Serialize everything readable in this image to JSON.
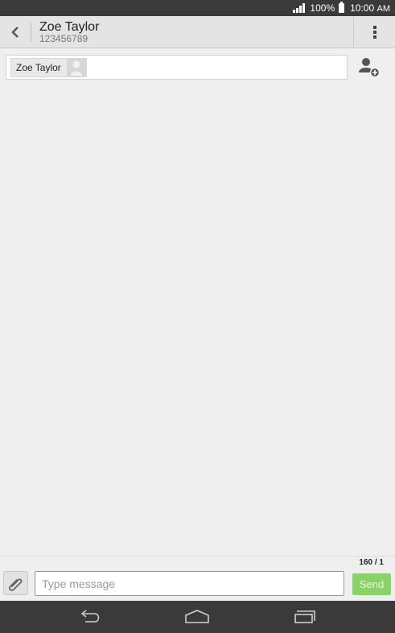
{
  "status_bar": {
    "battery": "100%",
    "time": "10:00",
    "ampm": "AM"
  },
  "header": {
    "contact_name": "Zoe Taylor",
    "contact_number": "123456789"
  },
  "recipients": {
    "chips": [
      {
        "name": "Zoe Taylor"
      }
    ]
  },
  "composer": {
    "char_counter": "160 / 1",
    "placeholder": "Type message",
    "value": "",
    "send_label": "Send"
  },
  "icons": {
    "back": "back-arrow-icon",
    "menu": "overflow-menu-icon",
    "add_contact": "add-contact-icon",
    "attach": "paperclip-icon",
    "nav_back": "nav-back-icon",
    "nav_home": "nav-home-icon",
    "nav_recents": "nav-recents-icon"
  },
  "colors": {
    "send_button": "#8ad26a",
    "input_border": "#4fb3c7",
    "status_bar": "#3a3a3a"
  }
}
